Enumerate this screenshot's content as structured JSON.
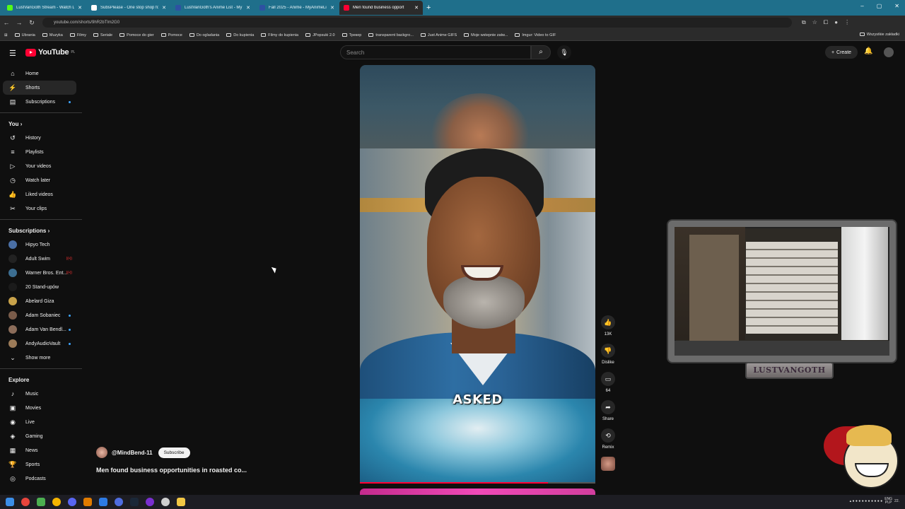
{
  "browser": {
    "tabs": [
      {
        "title": "LustVanGoth Stream - Watch L",
        "color": "#53fc18"
      },
      {
        "title": "SubsPlease - One stop shop fo",
        "color": "#ffffff"
      },
      {
        "title": "LustVanGoth's Anime List - My",
        "color": "#2e51a2"
      },
      {
        "title": "Fall 2025 - Anime - MyAnimeLi",
        "color": "#2e51a2"
      },
      {
        "title": "Men found business opport",
        "color": "#ff0033",
        "active": true
      }
    ],
    "url": "youtube.com/shorts/9hR2bTlm2G0",
    "bookmarks": [
      "Ubrania",
      "Muzyka",
      "Filmy",
      "Seriale",
      "Pomoce do gier",
      "Pomoce",
      "Do ogladania",
      "Do kupienia",
      "Filmy do kupienia",
      "JPopsuki 2.0",
      "Трекер",
      "transparent backgro...",
      "Just Anime GIFS",
      "Moje wstepnie zatw...",
      "Imgur: Video to GIF"
    ],
    "bookmarks_right": "Wszystkie zakładki"
  },
  "header": {
    "logo_text": "YouTube",
    "logo_region": "PL",
    "search_placeholder": "Search",
    "create_label": "Create"
  },
  "sidebar": {
    "main": [
      {
        "label": "Home",
        "icon": "home-icon",
        "glyph": "⌂"
      },
      {
        "label": "Shorts",
        "icon": "shorts-icon",
        "glyph": "⚡",
        "selected": true
      },
      {
        "label": "Subscriptions",
        "icon": "subscriptions-icon",
        "glyph": "▤"
      }
    ],
    "you_heading": "You",
    "you": [
      {
        "label": "History",
        "icon": "history-icon",
        "glyph": "↺"
      },
      {
        "label": "Playlists",
        "icon": "playlists-icon",
        "glyph": "≡"
      },
      {
        "label": "Your videos",
        "icon": "your-videos-icon",
        "glyph": "▷"
      },
      {
        "label": "Watch later",
        "icon": "watch-later-icon",
        "glyph": "◷"
      },
      {
        "label": "Liked videos",
        "icon": "liked-icon",
        "glyph": "👍"
      },
      {
        "label": "Your clips",
        "icon": "clips-icon",
        "glyph": "✂"
      }
    ],
    "subs_heading": "Subscriptions",
    "subs": [
      {
        "label": "Hipyo Tech",
        "color": "#4a6fa5"
      },
      {
        "label": "Adult Swim",
        "color": "#222222",
        "live": true
      },
      {
        "label": "Warner Bros. Ent...",
        "color": "#3c6e91",
        "live": true
      },
      {
        "label": "20 Stand-upów",
        "color": "#1b1b1b"
      },
      {
        "label": "Abelard Giza",
        "color": "#c8a24a"
      },
      {
        "label": "Adam Sobaniec",
        "color": "#7a5c4a",
        "dot": true
      },
      {
        "label": "Adam Van Bendl...",
        "color": "#8c6d5a",
        "dot": true
      },
      {
        "label": "AndyAudioVault",
        "color": "#9c7b58",
        "dot": true
      }
    ],
    "show_more": "Show more",
    "explore_heading": "Explore",
    "explore": [
      {
        "label": "Music",
        "icon": "music-icon",
        "glyph": "♪"
      },
      {
        "label": "Movies",
        "icon": "movies-icon",
        "glyph": "▣"
      },
      {
        "label": "Live",
        "icon": "live-icon",
        "glyph": "◉"
      },
      {
        "label": "Gaming",
        "icon": "gaming-icon",
        "glyph": "◈"
      },
      {
        "label": "News",
        "icon": "news-icon",
        "glyph": "▦"
      },
      {
        "label": "Sports",
        "icon": "sports-icon",
        "glyph": "🏆"
      },
      {
        "label": "Podcasts",
        "icon": "podcasts-icon",
        "glyph": "◎"
      }
    ]
  },
  "short": {
    "caption": "ASKED",
    "channel": "@MindBend-11",
    "subscribe_label": "Subscribe",
    "title": "Men found business opportunities in roasted co...",
    "progress": 0.8,
    "actions": [
      {
        "name": "like-button",
        "icon": "like-icon",
        "glyph": "👍",
        "label": "13K"
      },
      {
        "name": "dislike-button",
        "icon": "dislike-icon",
        "glyph": "👎",
        "label": "Dislike"
      },
      {
        "name": "comments-button",
        "icon": "comment-icon",
        "glyph": "▭",
        "label": "64"
      },
      {
        "name": "share-button",
        "icon": "share-icon",
        "glyph": "➦",
        "label": "Share"
      },
      {
        "name": "remix-button",
        "icon": "remix-icon",
        "glyph": "⟲",
        "label": "Remix"
      }
    ]
  },
  "overlay": {
    "nameplate": "LUSTVANGOTH"
  }
}
